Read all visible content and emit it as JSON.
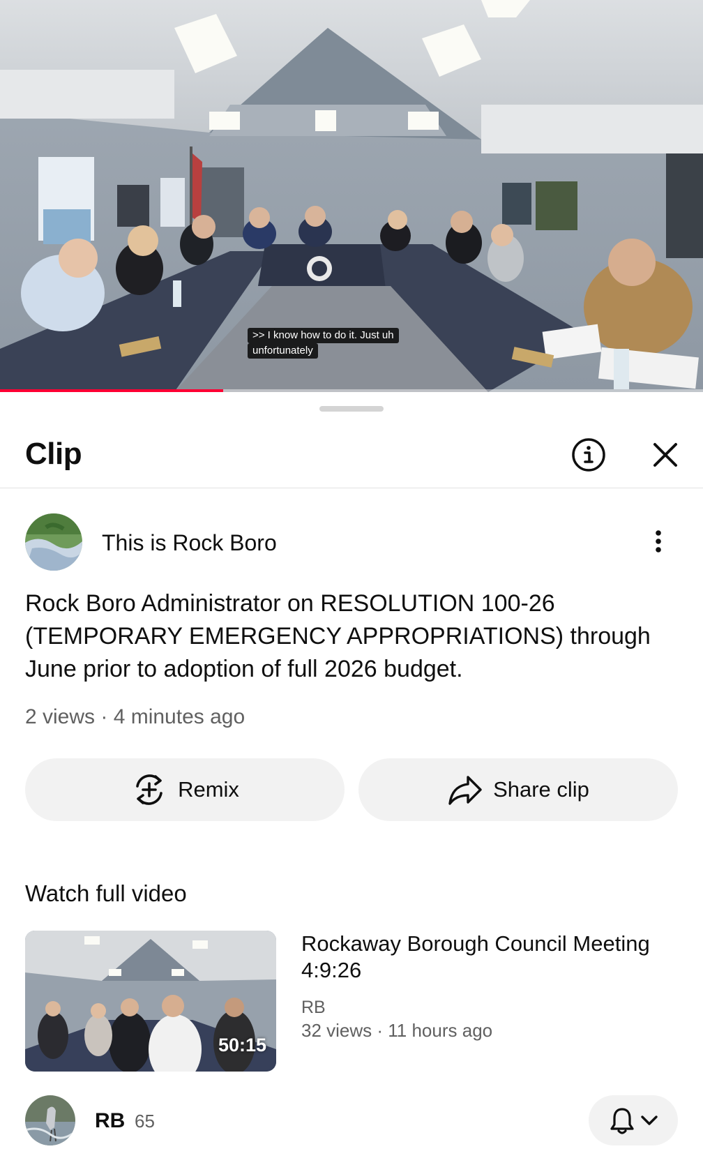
{
  "player": {
    "caption": ">> I know how to do it. Just uh unfortunately",
    "progress_fraction": 0.317,
    "progress_color": "#ff0033"
  },
  "sheet": {
    "title": "Clip",
    "info_icon": "info-icon",
    "close_icon": "close-icon"
  },
  "channel": {
    "name": "This is Rock Boro",
    "menu_icon": "more-vertical-icon"
  },
  "clip": {
    "title": "Rock Boro Administrator on RESOLUTION 100-26 (TEMPORARY EMERGENCY APPROPRIATIONS) through June prior to adoption of full 2026 budget.",
    "meta": "2 views · 4 minutes ago"
  },
  "actions": {
    "remix_label": "Remix",
    "remix_icon": "remix-icon",
    "share_label": "Share clip",
    "share_icon": "share-icon"
  },
  "full_video": {
    "section_label": "Watch full video",
    "title": "Rockaway Borough Council Meeting 4:9:26",
    "duration": "50:15",
    "channel": "RB",
    "meta": "32 views · 11 hours ago"
  },
  "subscription": {
    "channel": "RB",
    "count": "65",
    "bell_icon": "bell-icon",
    "chevron_icon": "chevron-down-icon"
  }
}
